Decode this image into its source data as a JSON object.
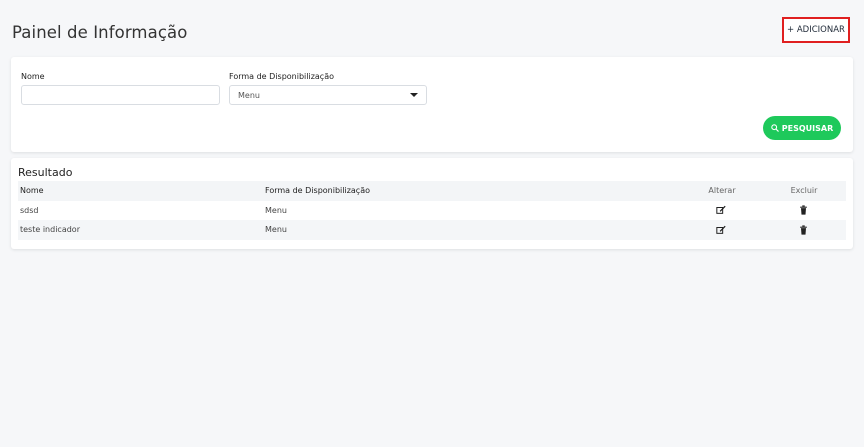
{
  "header": {
    "title": "Painel de Informação",
    "add_button": "+ ADICIONAR"
  },
  "filters": {
    "nome_label": "Nome",
    "nome_value": "",
    "forma_label": "Forma de Disponibilização",
    "forma_selected": "Menu",
    "search_button": "PESQUISAR"
  },
  "results": {
    "title": "Resultado",
    "columns": [
      "Nome",
      "Forma de Disponibilização",
      "Alterar",
      "Excluir"
    ],
    "rows": [
      {
        "nome": "sdsd",
        "forma": "Menu"
      },
      {
        "nome": "teste indicador",
        "forma": "Menu"
      }
    ]
  },
  "colors": {
    "accent_green": "#1ec95b",
    "highlight_red": "#e02020",
    "background": "#f6f7f9"
  },
  "icons": {
    "edit": "edit-icon",
    "delete": "trash-icon",
    "search": "search-icon",
    "dropdown": "chevron-down-icon"
  }
}
